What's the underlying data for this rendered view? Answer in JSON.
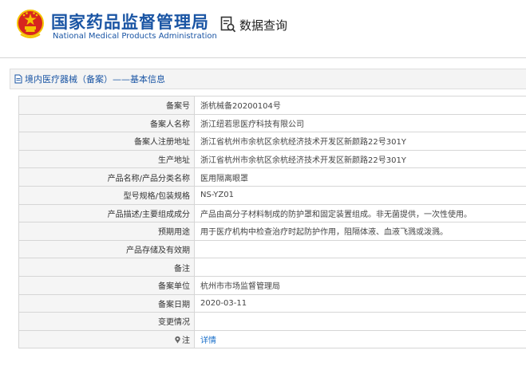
{
  "header": {
    "org_name_cn": "国家药品监督管理局",
    "org_name_en": "National Medical Products Administration",
    "search_title": "数据查询"
  },
  "breadcrumb": {
    "text": "境内医疗器械（备案）——基本信息"
  },
  "record": {
    "rows": [
      {
        "label": "备案号",
        "value": "浙杭械备20200104号"
      },
      {
        "label": "备案人名称",
        "value": "浙江纽若思医疗科技有限公司"
      },
      {
        "label": "备案人注册地址",
        "value": "浙江省杭州市余杭区余杭经济技术开发区新颜路22号301Y"
      },
      {
        "label": "生产地址",
        "value": "浙江省杭州市余杭区余杭经济技术开发区新颜路22号301Y"
      },
      {
        "label": "产品名称/产品分类名称",
        "value": "医用隔离眼罩"
      },
      {
        "label": "型号规格/包装规格",
        "value": "NS-YZ01"
      },
      {
        "label": "产品描述/主要组成成分",
        "value": "产品由高分子材料制成的防护罩和固定装置组成。非无菌提供，一次性使用。"
      },
      {
        "label": "预期用途",
        "value": "用于医疗机构中检查治疗时起防护作用，阻隔体液、血液飞溅或泼溅。"
      },
      {
        "label": "产品存储及有效期",
        "value": ""
      },
      {
        "label": "备注",
        "value": ""
      },
      {
        "label": "备案单位",
        "value": "杭州市市场监督管理局"
      },
      {
        "label": "备案日期",
        "value": "2020-03-11"
      },
      {
        "label": "变更情况",
        "value": ""
      }
    ],
    "note_label": "注",
    "note_link": "详情"
  },
  "colors": {
    "brand_blue": "#1a55a4",
    "link_blue": "#1a6fc9",
    "emblem_red": "#d7261e",
    "emblem_gold": "#f5c400"
  }
}
